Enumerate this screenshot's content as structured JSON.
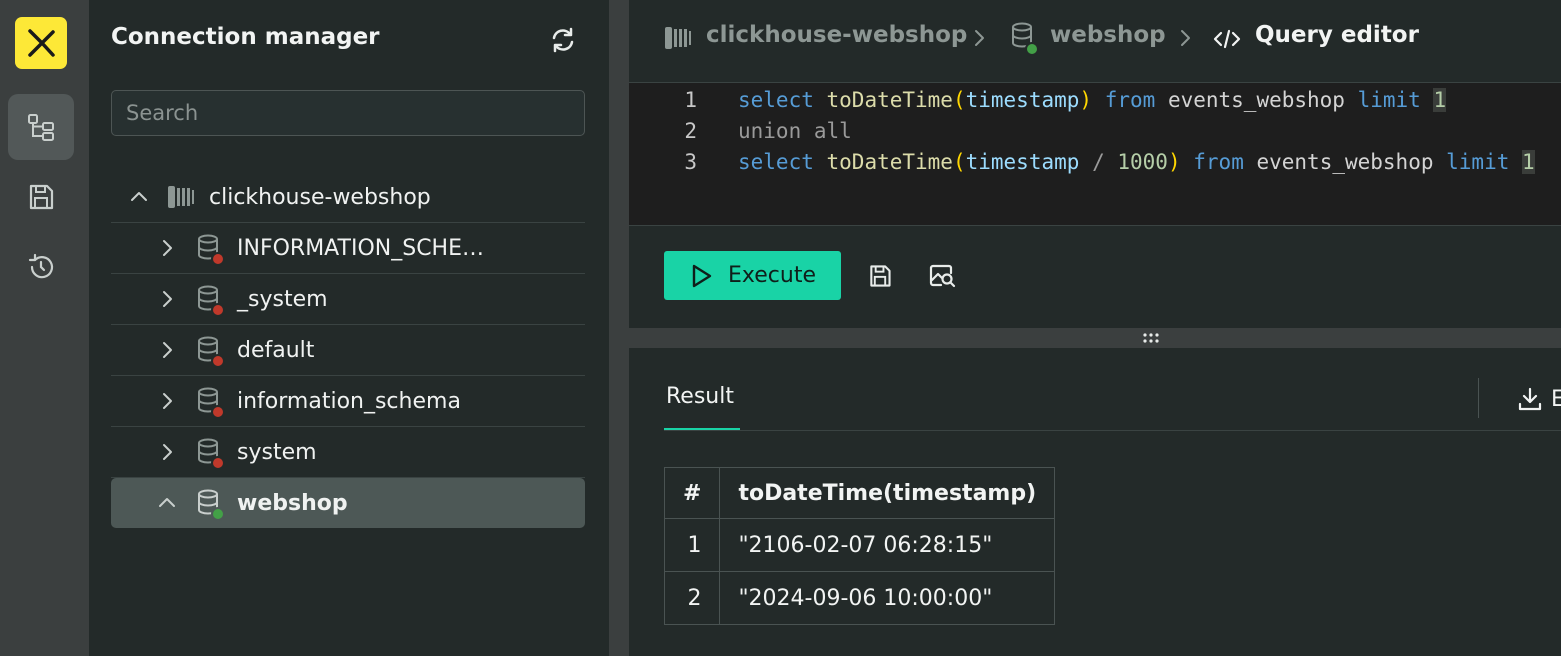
{
  "sidebar_nav": {
    "items": [
      {
        "icon": "database-tree-icon",
        "active": true
      },
      {
        "icon": "save-icon",
        "active": false
      },
      {
        "icon": "history-icon",
        "active": false
      }
    ]
  },
  "connection_panel": {
    "title": "Connection manager",
    "search_placeholder": "Search",
    "connection": {
      "label": "clickhouse-webshop",
      "expanded": true
    },
    "databases": [
      {
        "label": "INFORMATION_SCHE…",
        "status": "disconnected",
        "expanded": false
      },
      {
        "label": "_system",
        "status": "disconnected",
        "expanded": false
      },
      {
        "label": "default",
        "status": "disconnected",
        "expanded": false
      },
      {
        "label": "information_schema",
        "status": "disconnected",
        "expanded": false
      },
      {
        "label": "system",
        "status": "disconnected",
        "expanded": false
      },
      {
        "label": "webshop",
        "status": "connected",
        "expanded": true,
        "selected": true
      }
    ]
  },
  "breadcrumb": {
    "connection": "clickhouse-webshop",
    "database": "webshop",
    "page": "Query editor"
  },
  "editor": {
    "lines": [
      {
        "number": "1",
        "text": "select toDateTime(timestamp) from events_webshop limit 1"
      },
      {
        "number": "2",
        "text": "union all"
      },
      {
        "number": "3",
        "text": "select toDateTime(timestamp / 1000) from events_webshop limit 1"
      }
    ]
  },
  "toolbar": {
    "execute_label": "Execute"
  },
  "results": {
    "tab_label": "Result",
    "export_label": "E",
    "columns": [
      "#",
      "toDateTime(timestamp)"
    ],
    "rows": [
      [
        "1",
        "\"2106-02-07 06:28:15\""
      ],
      [
        "2",
        "\"2024-09-06 10:00:00\""
      ]
    ]
  },
  "colors": {
    "accent": "#19d3a6",
    "logo": "#fde837",
    "connected": "#43a047",
    "disconnected": "#c0392b"
  }
}
